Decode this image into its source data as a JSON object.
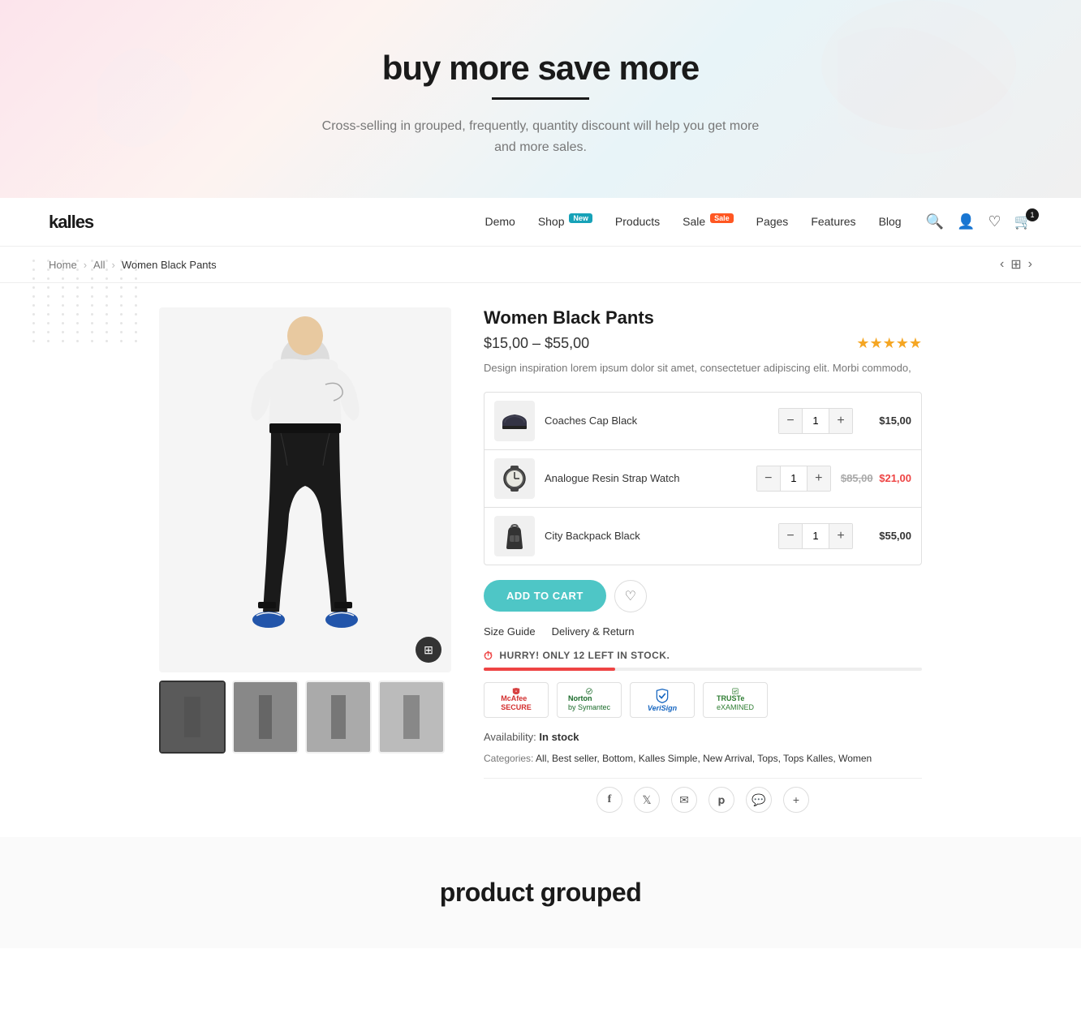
{
  "hero": {
    "title": "buy more save more",
    "subtitle": "Cross-selling in grouped, frequently,  quantity discount will help you get more and more sales."
  },
  "navbar": {
    "logo": "kalles",
    "items": [
      {
        "label": "Demo",
        "badge": null
      },
      {
        "label": "Shop",
        "badge": "New"
      },
      {
        "label": "Products",
        "badge": null
      },
      {
        "label": "Sale",
        "badge": "Sale"
      },
      {
        "label": "Pages",
        "badge": null
      },
      {
        "label": "Features",
        "badge": null
      },
      {
        "label": "Blog",
        "badge": null
      }
    ],
    "cart_count": "1",
    "wishlist_count": "0"
  },
  "breadcrumb": {
    "home": "Home",
    "all": "All",
    "current": "Women Black Pants"
  },
  "product": {
    "title": "Women Black Pants",
    "price": "$15,00 – $55,00",
    "description": "Design inspiration lorem ipsum dolor sit amet, consectetuer adipiscing elit. Morbi commodo,",
    "availability": "In stock",
    "categories": "All, Best seller, Bottom, Kalles Simple, New Arrival, Tops, Tops Kalles, Women",
    "grouped_items": [
      {
        "name": "Coaches Cap Black",
        "qty": 1,
        "price": "$15,00",
        "price_old": null,
        "price_sale": null,
        "thumb_color": "#555577"
      },
      {
        "name": "Analogue Resin Strap Watch",
        "qty": 1,
        "price": "$85,00",
        "price_old": "$85,00",
        "price_sale": "$21,00",
        "thumb_color": "#444"
      },
      {
        "name": "City Backpack Black",
        "qty": 1,
        "price": "$55,00",
        "price_old": null,
        "price_sale": null,
        "thumb_color": "#333"
      }
    ],
    "add_to_cart_label": "ADD TO CART",
    "size_guide": "Size Guide",
    "delivery_return": "Delivery & Return",
    "stock_warning": "HURRY! ONLY 12 LEFT IN STOCK.",
    "trust_badges": [
      {
        "label": "McAfee\nSECURE",
        "type": "mcafee"
      },
      {
        "label": "Norton\nby Symantec",
        "type": "norton"
      },
      {
        "label": "VeriSign",
        "type": "verisign"
      },
      {
        "label": "TRUSTe\nexAMINED",
        "type": "truste"
      }
    ]
  },
  "bottom": {
    "title": "product grouped"
  },
  "icons": {
    "search": "🔍",
    "user": "👤",
    "heart": "♡",
    "cart": "🛒",
    "zoom": "⊞",
    "timer": "⏱",
    "facebook": "f",
    "twitter": "t",
    "email": "✉",
    "pinterest": "p",
    "messenger": "m",
    "more": "+"
  }
}
